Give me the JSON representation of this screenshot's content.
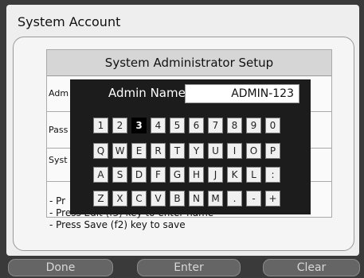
{
  "window": {
    "title": "System Account"
  },
  "setup": {
    "header": "System Administrator Setup",
    "rows": [
      {
        "label": "Adm"
      },
      {
        "label": "Pass"
      },
      {
        "label": "Syst"
      }
    ],
    "instructions": [
      "- Pr",
      "- Press Edit (f3) key to enter name",
      "- Press Save (f2) key to save"
    ]
  },
  "keyboard": {
    "field_label": "Admin Name",
    "field_value": "ADMIN-123",
    "selected_key": "3",
    "rows": [
      [
        "1",
        "2",
        "3",
        "4",
        "5",
        "6",
        "7",
        "8",
        "9",
        "0"
      ],
      [
        "Q",
        "W",
        "E",
        "R",
        "T",
        "Y",
        "U",
        "I",
        "O",
        "P"
      ],
      [
        "A",
        "S",
        "D",
        "F",
        "G",
        "H",
        "J",
        "K",
        "L",
        ":"
      ],
      [
        "Z",
        "X",
        "C",
        "V",
        "B",
        "N",
        "M",
        ".",
        "-",
        "+"
      ]
    ]
  },
  "buttons": {
    "done": "Done",
    "enter": "Enter",
    "clear": "Clear"
  }
}
